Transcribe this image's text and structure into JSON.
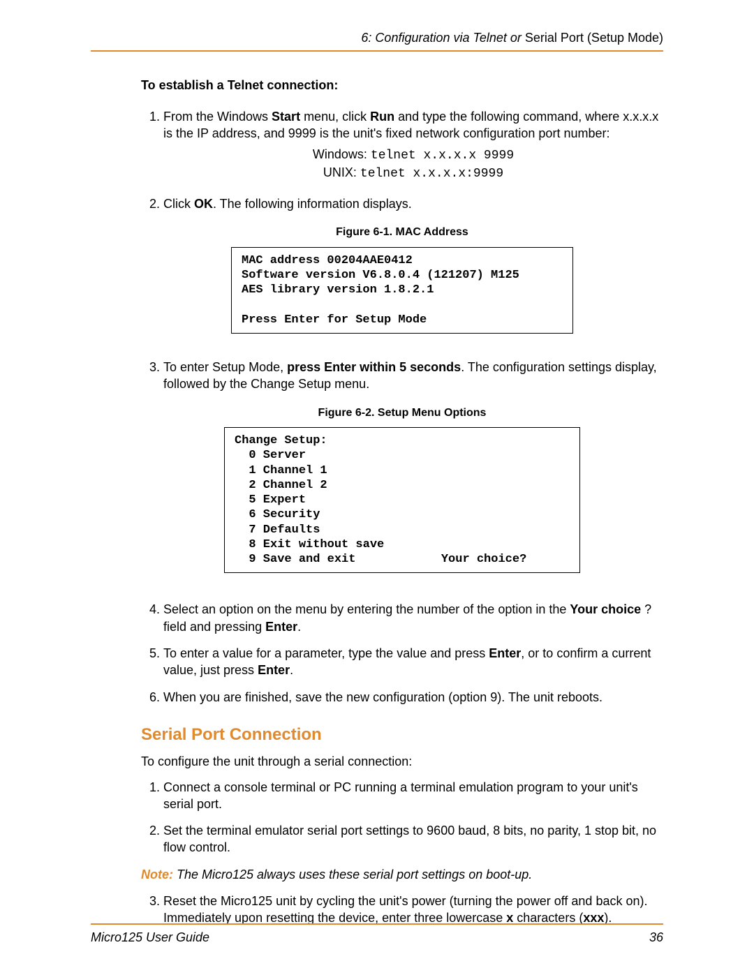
{
  "header": {
    "italic_prefix": "6: Configuration via Telnet or ",
    "plain_suffix": "Serial Port (Setup Mode)"
  },
  "telnet": {
    "heading": "To establish a Telnet connection:",
    "step1_a": "From the Windows ",
    "step1_b": "Start",
    "step1_c": " menu, click ",
    "step1_d": "Run",
    "step1_e": " and type the following command, where x.x.x.x is the IP address, and 9999 is the unit's fixed network configuration port number:",
    "cmd_win_label": "Windows: ",
    "cmd_win_cmd": "telnet x.x.x.x 9999",
    "cmd_unix_label": "UNIX: ",
    "cmd_unix_cmd": "telnet x.x.x.x:9999",
    "step2_a": "Click ",
    "step2_b": "OK",
    "step2_c": ". The following information displays.",
    "fig1_caption": "Figure 6-1. MAC Address",
    "fig1_text": "MAC address 00204AAE0412\nSoftware version V6.8.0.4 (121207) M125\nAES library version 1.8.2.1\n\nPress Enter for Setup Mode",
    "step3_a": "To enter Setup Mode, ",
    "step3_b": "press Enter within 5 seconds",
    "step3_c": ". The configuration settings display, followed by the Change Setup menu.",
    "fig2_caption": "Figure 6-2. Setup Menu Options",
    "fig2_text": "Change Setup:\n  0 Server\n  1 Channel 1\n  2 Channel 2\n  5 Expert\n  6 Security\n  7 Defaults\n  8 Exit without save\n  9 Save and exit            Your choice?",
    "step4_a": "Select an option on the menu by entering the number of the option in the ",
    "step4_b": "Your choice",
    "step4_c": " ? field and pressing ",
    "step4_d": "Enter",
    "step4_e": ".",
    "step5_a": "To enter a value for a parameter, type the value and press ",
    "step5_b": "Enter",
    "step5_c": ", or to confirm a current value, just press ",
    "step5_d": "Enter",
    "step5_e": ".",
    "step6": "When you are finished, save the new configuration (option 9). The unit reboots."
  },
  "serial": {
    "title": "Serial Port Connection",
    "intro": "To configure the unit through a serial connection:",
    "step1": "Connect a console terminal or PC running a terminal emulation program to your unit's serial port.",
    "step2": "Set the terminal emulator serial port settings to 9600 baud, 8 bits, no parity, 1 stop bit, no flow control.",
    "note_label": "Note:",
    "note_text": "  The Micro125 always uses these serial port settings on boot-up.",
    "step3_a": "Reset the Micro125 unit by cycling the unit's power (turning the power off and back on). Immediately upon resetting the device, enter three lowercase ",
    "step3_b": "x",
    "step3_c": " characters (",
    "step3_d": "xxx",
    "step3_e": ")."
  },
  "footer": {
    "left": "Micro125 User Guide",
    "right": "36"
  }
}
